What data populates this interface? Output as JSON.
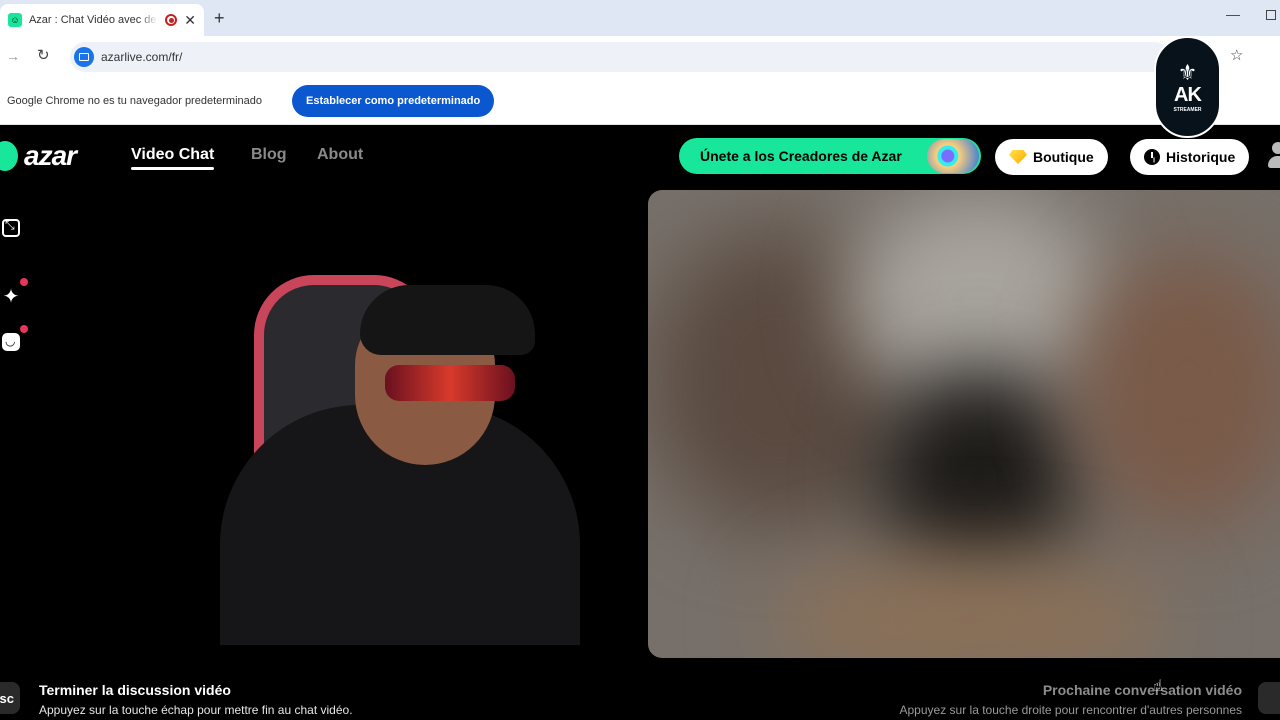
{
  "browser": {
    "tab_title": "Azar : Chat Vidéo avec de n",
    "url": "azarlive.com/fr/",
    "infobar_text": "Google Chrome no es tu navegador predeterminado",
    "default_button": "Establecer como predeterminado"
  },
  "watermark": {
    "letters": "AK",
    "sub": "STREAMER"
  },
  "nav": {
    "logo": "azar",
    "links": [
      "Video Chat",
      "Blog",
      "About"
    ],
    "creators_button": "Únete a los Creadores de Azar",
    "boutique_button": "Boutique",
    "history_button": "Historique"
  },
  "footer": {
    "esc_key": "sc",
    "end_title": "Terminer la discussion vidéo",
    "end_desc": "Appuyez sur la touche échap pour mettre fin au chat vidéo.",
    "next_title": "Prochaine conversation vidéo",
    "next_desc": "Appuyez sur la touche droite pour rencontrer d'autres personnes"
  },
  "colors": {
    "brand_green": "#18e79b",
    "chrome_blue": "#0b57d0",
    "notification_red": "#e8355b"
  }
}
